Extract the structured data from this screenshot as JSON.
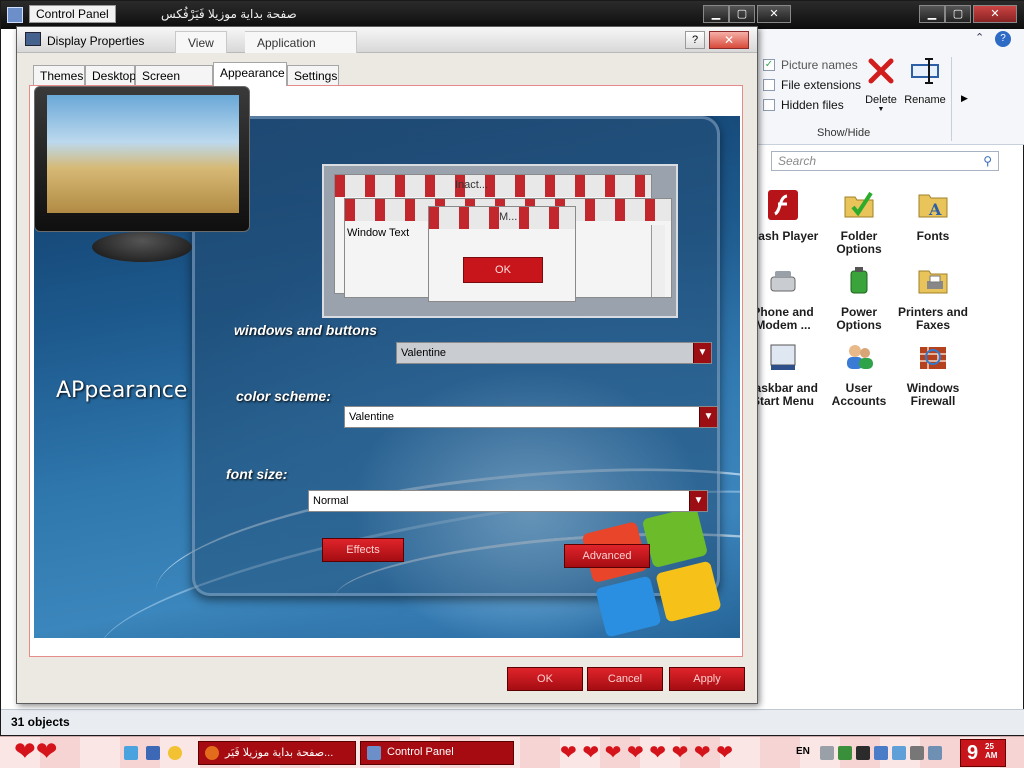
{
  "background_window": {
    "title": "Control Panel",
    "browser_title": "صفحة بداية موزيلا فَيَرْفُكس",
    "controls": {
      "minimize": "▁",
      "maximize": "▢",
      "close": "✕"
    },
    "ribbon": {
      "checks": [
        {
          "label": "Picture names",
          "checked": true,
          "disabled": true
        },
        {
          "label": "File extensions",
          "checked": false,
          "disabled": false
        },
        {
          "label": "Hidden files",
          "checked": false,
          "disabled": false
        }
      ],
      "delete_label": "Delete",
      "rename_label": "Rename",
      "group_label": "Show/Hide"
    },
    "search": {
      "placeholder": "Search"
    },
    "items": [
      {
        "label": "Flash Player",
        "icon": "flash-icon"
      },
      {
        "label": "Folder Options",
        "icon": "folder-options-icon"
      },
      {
        "label": "Fonts",
        "icon": "fonts-icon"
      },
      {
        "label": "Phone and Modem ...",
        "icon": "phone-modem-icon"
      },
      {
        "label": "Power Options",
        "icon": "power-options-icon"
      },
      {
        "label": "Printers and Faxes",
        "icon": "printers-icon"
      },
      {
        "label": "Taskbar and Start Menu",
        "icon": "taskbar-icon"
      },
      {
        "label": "User Accounts",
        "icon": "user-accounts-icon"
      },
      {
        "label": "Windows Firewall",
        "icon": "firewall-icon"
      }
    ],
    "status": "31 objects"
  },
  "dialog": {
    "title": "Display Properties",
    "ghost_tabs": [
      "View",
      "Application"
    ],
    "help": "?",
    "close": "✕",
    "tabs": [
      "Themes",
      "Desktop",
      "Screen Saver",
      "Appearance",
      "Settings"
    ],
    "active_tab": "Appearance",
    "heading": "APpearance",
    "preview": {
      "inactive_title": "Inact...",
      "active_title": "M...",
      "window_text": "Window Text",
      "ok_label": "OK"
    },
    "fields": {
      "windows_buttons": {
        "label": "windows and buttons",
        "value": "Valentine"
      },
      "color_scheme": {
        "label": "color scheme:",
        "value": "Valentine"
      },
      "font_size": {
        "label": "font size:",
        "value": "Normal"
      }
    },
    "effects_label": "Effects",
    "advanced_label": "Advanced",
    "buttons": {
      "ok": "OK",
      "cancel": "Cancel",
      "apply": "Apply"
    }
  },
  "taskbar": {
    "tasks": [
      {
        "label": "صفحة بداية موزيلا فَيَر...",
        "color": "#e36b1c"
      },
      {
        "label": "Control Panel",
        "color": "#6d8fc9"
      }
    ],
    "language": "EN",
    "clock_hour": "9",
    "clock_min": "25",
    "clock_ampm": "AM"
  },
  "colors": {
    "accent_red": "#c8151b",
    "scene_blue": "#1e5a8e"
  }
}
